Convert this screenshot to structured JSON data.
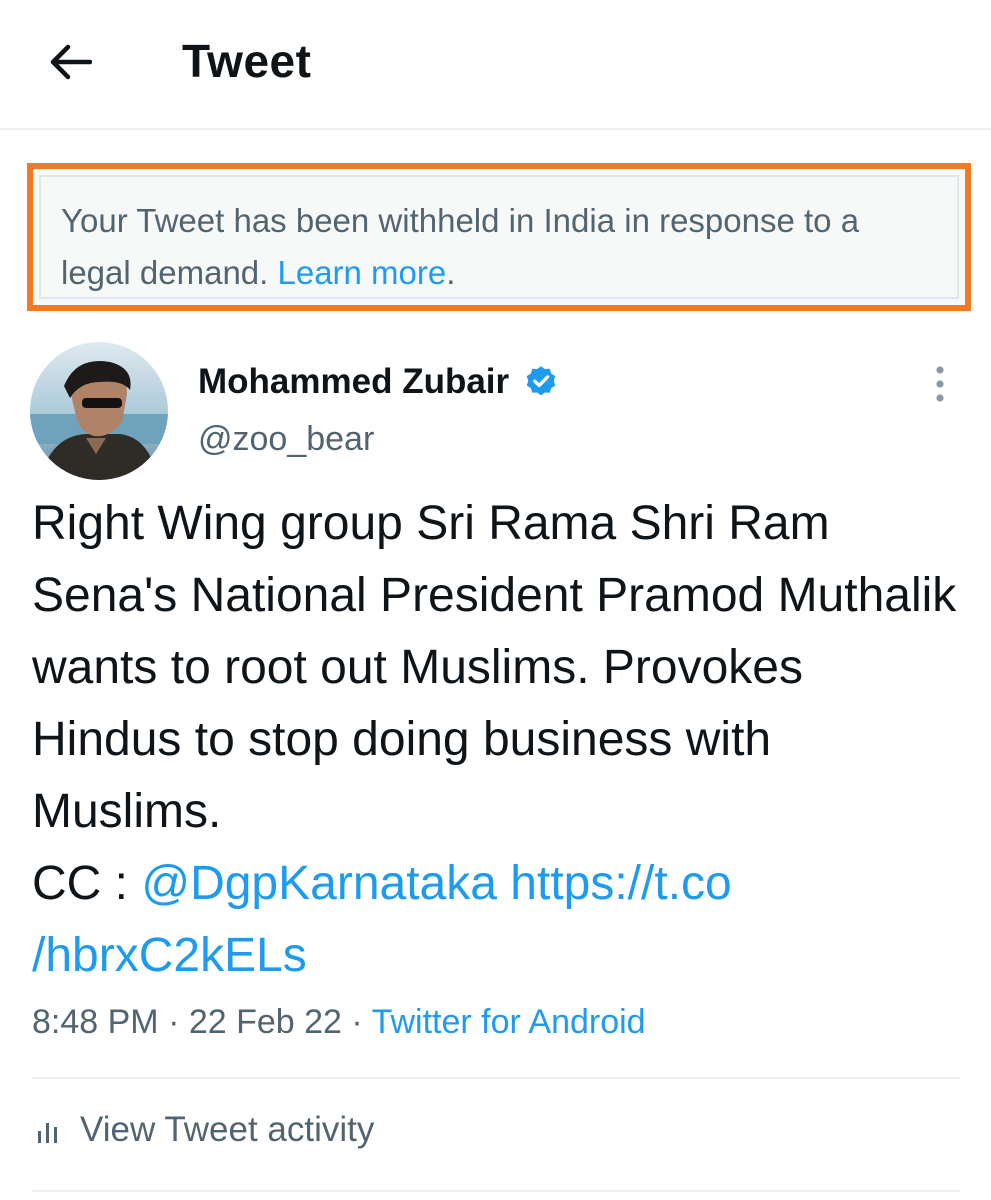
{
  "header": {
    "title": "Tweet"
  },
  "notice": {
    "text": "Your Tweet has been withheld in India in response to a legal demand. ",
    "link": "Learn more",
    "suffix": "."
  },
  "tweet": {
    "author": {
      "name": "Mohammed Zubair",
      "handle": "@zoo_bear",
      "verified": true
    },
    "body": "Right Wing group Sri Rama Shri Ram Sena's National President Pramod Muthalik wants to root out Muslims. Provokes Hindus to stop doing business with Muslims.",
    "cc_prefix": "CC : ",
    "mention": "@DgpKarnataka",
    "url_line1": "https://t.co",
    "url_line2": "/hbrxC2kELs",
    "time": "8:48 PM",
    "sep1": " · ",
    "date": "22 Feb 22",
    "sep2": " · ",
    "source": "Twitter for Android"
  },
  "activity": {
    "label": "View Tweet activity"
  },
  "colors": {
    "accent": "#1d9bf0",
    "notice_border": "#f47a20",
    "muted_text": "#536471"
  },
  "icons": {
    "back": "arrow-left-icon",
    "verified": "verified-badge-icon",
    "more": "more-vertical-icon",
    "activity": "bar-chart-icon"
  }
}
